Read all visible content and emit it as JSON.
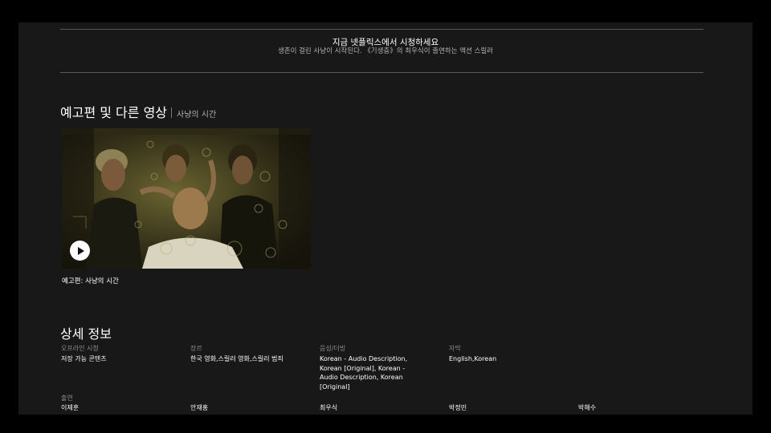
{
  "banner": {
    "title": "지금 넷플릭스에서 시청하세요",
    "description": "생존이 걸린 사냥이 시작된다. 《기생충》의 최우식이 출연하는 액션 스릴러"
  },
  "trailers": {
    "heading": "예고편 및 다른 영상",
    "subtitle": "사냥의 시간",
    "items": [
      {
        "caption": "예고편: 사냥의 시간"
      }
    ]
  },
  "details": {
    "heading": "상세 정보",
    "columns": [
      {
        "label": "오프라인 시청",
        "value": "저장 가능 콘텐츠"
      },
      {
        "label": "장르",
        "value": "한국 영화,스릴러 영화,스릴러 범죄"
      },
      {
        "label": "음성/더빙",
        "value": "Korean - Audio Description, Korean [Original], Korean - Audio Description, Korean [Original]"
      },
      {
        "label": "자막",
        "value": "English,Korean"
      }
    ],
    "cast_label": "출연",
    "cast": [
      "이제훈",
      "안재홍",
      "최우식",
      "박정민",
      "박해수"
    ]
  }
}
